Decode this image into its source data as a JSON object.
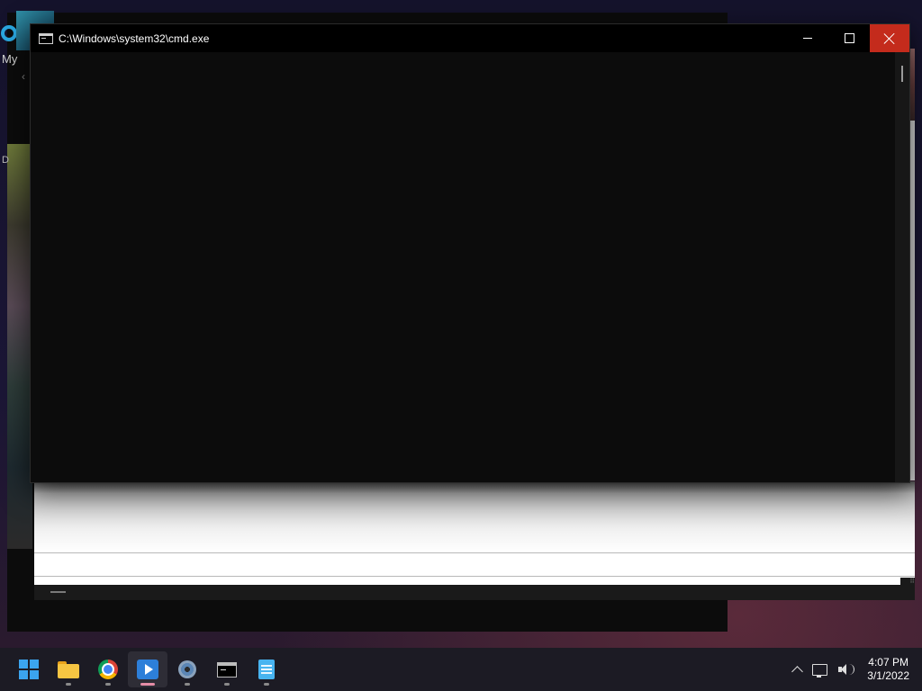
{
  "background_app": {
    "label": "My",
    "small_label": "D"
  },
  "cmd_window": {
    "title": "C:\\Windows\\system32\\cmd.exe",
    "console_text": ""
  },
  "taskbar": {
    "items": [
      {
        "name": "start",
        "icon": "windows-logo-icon"
      },
      {
        "name": "file-explorer",
        "icon": "folder-icon"
      },
      {
        "name": "chrome",
        "icon": "chrome-icon"
      },
      {
        "name": "media-player",
        "icon": "media-player-icon",
        "active": true
      },
      {
        "name": "settings",
        "icon": "gear-icon"
      },
      {
        "name": "command-prompt",
        "icon": "terminal-icon"
      },
      {
        "name": "notepad",
        "icon": "notepad-icon"
      }
    ],
    "clock": {
      "time": "4:07 PM",
      "date": "3/1/2022"
    }
  },
  "colors": {
    "close_button": "#c42b1c",
    "taskbar": "#1c1b24",
    "console_bg": "#0c0c0c",
    "active_indicator": "#e58ca6"
  }
}
